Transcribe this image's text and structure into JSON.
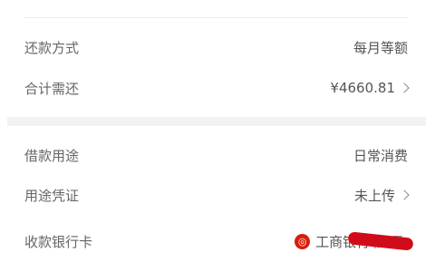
{
  "rows": [
    {
      "label": "还款方式",
      "value": "每月等额"
    },
    {
      "label": "合计需还",
      "value": "¥4660.81"
    },
    {
      "label": "借款用途",
      "value": "日常消费"
    },
    {
      "label": "用途凭证",
      "value": "未上传"
    },
    {
      "label": "收款银行卡",
      "value": "工商银行"
    }
  ],
  "bank": {
    "logo_text": "◎",
    "tail_text": "(尾号"
  },
  "colors": {
    "divider": "#ececec",
    "section_gap": "#f2f2f2",
    "bank_logo": "#d81e06",
    "redaction": "#d10c1a"
  }
}
